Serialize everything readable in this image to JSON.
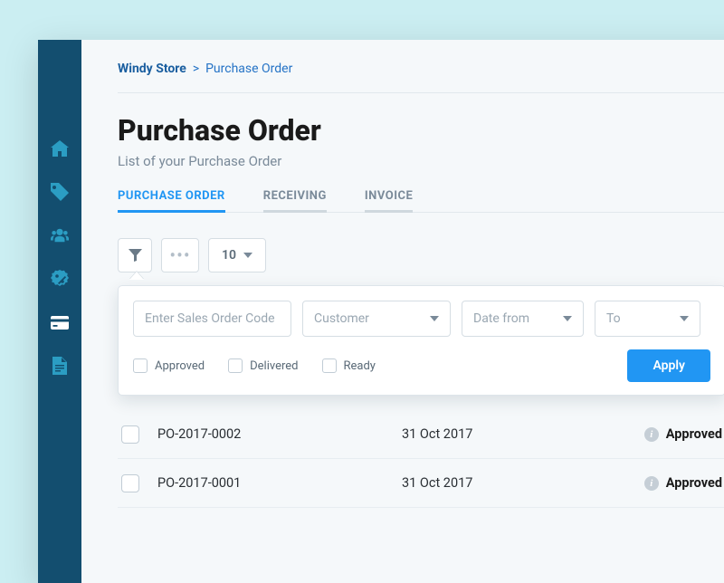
{
  "breadcrumb": {
    "root": "Windy Store",
    "sep": ">",
    "current": "Purchase Order"
  },
  "page": {
    "title": "Purchase Order",
    "subtitle": "List of your Purchase Order"
  },
  "tabs": {
    "t0": "PURCHASE ORDER",
    "t1": "RECEIVING",
    "t2": "INVOICE"
  },
  "toolbar": {
    "page_size": "10"
  },
  "filter": {
    "code_placeholder": "Enter Sales Order Code",
    "customer_label": "Customer",
    "date_from_label": "Date from",
    "date_to_label": "To",
    "chk_approved": "Approved",
    "chk_delivered": "Delivered",
    "chk_ready": "Ready",
    "apply_label": "Apply"
  },
  "rows": [
    {
      "code": "PO-2017-0002",
      "date": "31 Oct 2017",
      "status": "Approved"
    },
    {
      "code": "PO-2017-0001",
      "date": "31 Oct 2017",
      "status": "Approved"
    }
  ]
}
